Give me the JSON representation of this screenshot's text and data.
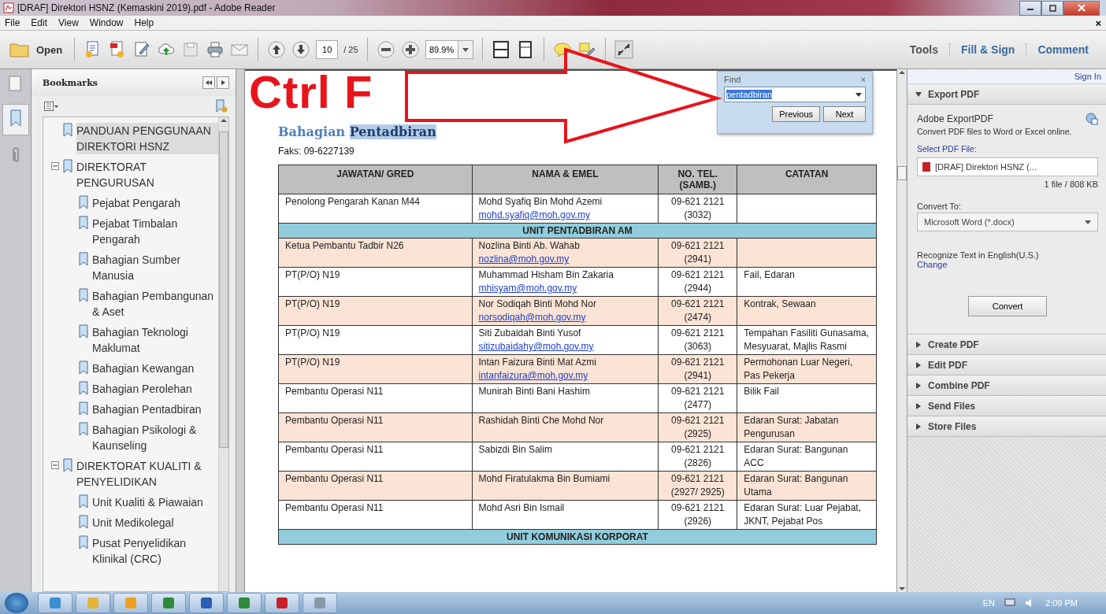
{
  "window": {
    "title": "[DRAF] Direktori HSNZ (Kemaskini 2019).pdf - Adobe Reader"
  },
  "menu": [
    "File",
    "Edit",
    "View",
    "Window",
    "Help"
  ],
  "menu_close": "×",
  "toolbar": {
    "open_label": "Open",
    "page_number": "10",
    "page_total": "/ 25",
    "zoom": "89.9%",
    "right_tabs": [
      "Tools",
      "Fill & Sign",
      "Comment"
    ]
  },
  "bookmarks": {
    "title": "Bookmarks",
    "items": [
      {
        "label": "PANDUAN PENGGUNAAN DIREKTORI HSNZ",
        "selected": true
      },
      {
        "label": "DIREKTORAT PENGURUSAN",
        "selected": false,
        "expanded": true,
        "children": [
          {
            "label": "Pejabat Pengarah",
            "selected": false
          },
          {
            "label": "Pejabat Timbalan Pengarah",
            "selected": false
          },
          {
            "label": "Bahagian Sumber Manusia",
            "selected": false
          },
          {
            "label": "Bahagian Pembangunan & Aset",
            "selected": false
          },
          {
            "label": "Bahagian Teknologi Maklumat",
            "selected": false
          },
          {
            "label": "Bahagian Kewangan",
            "selected": false
          },
          {
            "label": "Bahagian Perolehan",
            "selected": false
          },
          {
            "label": "Bahagian Pentadbiran",
            "selected": false
          },
          {
            "label": "Bahagian Psikologi & Kaunseling",
            "selected": false
          }
        ]
      },
      {
        "label": "DIREKTORAT KUALITI & PENYELIDIKAN",
        "selected": false,
        "expanded": true,
        "children": [
          {
            "label": "Unit Kualiti & Piawaian",
            "selected": false
          },
          {
            "label": "Unit Medikolegal",
            "selected": false
          },
          {
            "label": "Pusat Penyelidikan Klinikal (CRC)",
            "selected": false
          }
        ]
      }
    ]
  },
  "annotation": {
    "label": "Ctrl F"
  },
  "find": {
    "title": "Find",
    "close": "×",
    "value": "pentadbiran",
    "buttons": [
      "Previous",
      "Next"
    ]
  },
  "document": {
    "heading_parts": [
      {
        "text": "Bahagian",
        "highlighted": false
      },
      {
        "text": "Pentadbiran",
        "highlighted": true
      }
    ],
    "fax": "Faks: 09-6227139",
    "columns": [
      "JAWATAN/ GRED",
      "NAMA & EMEL",
      "NO. TEL. (SAMB.)",
      "CATATAN"
    ],
    "rows": [
      {
        "kind": "person",
        "shaded": false,
        "position": "Penolong Pengarah Kanan M44",
        "name": "Mohd Syafiq Bin Mohd Azemi",
        "email": "mohd.syafiq@moh.gov.my",
        "phone": "09-621 2121",
        "extension": "(3032)"
      },
      {
        "kind": "section",
        "title": "UNIT PENTADBIRAN AM"
      },
      {
        "kind": "person",
        "shaded": true,
        "position": "Ketua Pembantu Tadbir N26",
        "name": "Nozlina Binti Ab. Wahab",
        "email": "nozlina@moh.gov.my",
        "phone": "09-621 2121",
        "extension": "(2941)"
      },
      {
        "kind": "person",
        "shaded": false,
        "position": "PT(P/O) N19",
        "name": "Muhammad Hisham Bin Zakaria",
        "email": "mhisyam@moh.gov.my",
        "phone": "09-621 2121",
        "extension": "(2944)",
        "notes": "Fail, Edaran"
      },
      {
        "kind": "person",
        "shaded": true,
        "position": "PT(P/O) N19",
        "name": "Nor Sodiqah Binti Mohd Nor",
        "email": "norsodiqah@moh.gov.my",
        "phone": "09-621 2121",
        "extension": "(2474)",
        "notes": "Kontrak, Sewaan"
      },
      {
        "kind": "person",
        "shaded": false,
        "position": "PT(P/O) N19",
        "name": "Siti Zubaidah Binti Yusof",
        "email": "sitizubaidahy@moh.gov.my",
        "phone": "09-621 2121",
        "extension": "(3063)",
        "notes": "Tempahan Fasiliti Gunasama, Mesyuarat, Majlis Rasmi"
      },
      {
        "kind": "person",
        "shaded": true,
        "position": "PT(P/O) N19",
        "name": "Intan Faizura Binti Mat Azmi",
        "email": "intanfaizura@moh.gov.my",
        "phone": "09-621 2121",
        "extension": "(2941)",
        "notes": "Permohonan Luar Negeri, Pas Pekerja"
      },
      {
        "kind": "person",
        "shaded": false,
        "position": "Pembantu Operasi N11",
        "name": "Munirah Binti Bani Hashim",
        "phone": "09-621 2121",
        "extension": "(2477)",
        "notes": "Bilik Fail"
      },
      {
        "kind": "person",
        "shaded": true,
        "position": "Pembantu Operasi N11",
        "name": "Rashidah Binti Che Mohd Nor",
        "phone": "09-621 2121",
        "extension": "(2925)",
        "notes": "Edaran Surat: Jabatan Pengurusan"
      },
      {
        "kind": "person",
        "shaded": false,
        "position": "Pembantu Operasi N11",
        "name": "Sabizdi Bin Salim",
        "phone": "09-621 2121",
        "extension": "(2826)",
        "notes": "Edaran Surat: Bangunan ACC"
      },
      {
        "kind": "person",
        "shaded": true,
        "position": "Pembantu Operasi N11",
        "name": "Mohd Firatulakma Bin Bumiami",
        "phone": "09-621 2121",
        "extension": "(2927/ 2925)",
        "notes": "Edaran Surat: Bangunan Utama"
      },
      {
        "kind": "person",
        "shaded": false,
        "position": "Pembantu Operasi N11",
        "name": "Mohd Asri Bin Ismail",
        "phone": "09-621 2121",
        "extension": "(2926)",
        "notes": "Edaran Surat: Luar Pejabat, JKNT, Pejabat Pos"
      },
      {
        "kind": "section",
        "title": "UNIT KOMUNIKASI KORPORAT"
      }
    ]
  },
  "right_panel": {
    "sign_in": "Sign In",
    "sections": [
      {
        "label": "Export PDF",
        "expanded": true
      },
      {
        "label": "Create PDF",
        "expanded": false
      },
      {
        "label": "Edit PDF",
        "expanded": false
      },
      {
        "label": "Combine PDF",
        "expanded": false
      },
      {
        "label": "Send Files",
        "expanded": false
      },
      {
        "label": "Store Files",
        "expanded": false
      }
    ],
    "export": {
      "title": "Adobe ExportPDF",
      "description": "Convert PDF files to Word or Excel online.",
      "select_label": "Select PDF File:",
      "file_name": "[DRAF] Direktori HSNZ (...",
      "file_info": "1 file / 808 KB",
      "convert_to_label": "Convert To:",
      "format": "Microsoft Word (*.docx)",
      "ocr_text": "Recognize Text in English(U.S.)",
      "change_link": "Change",
      "convert_button": "Convert"
    }
  },
  "taskbar": {
    "language": "EN",
    "time": "2:09 PM"
  }
}
